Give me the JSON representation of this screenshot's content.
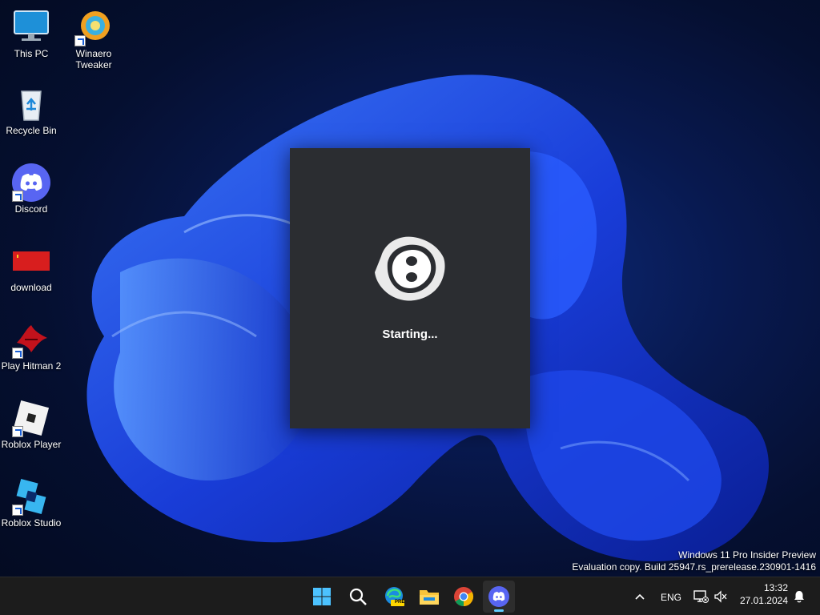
{
  "desktop": {
    "icons": [
      {
        "label_lines": [
          "This PC"
        ],
        "icon": "monitor-icon"
      },
      {
        "label_lines": [
          "Winaero",
          "Tweaker"
        ],
        "icon": "winaero-tweaker-icon"
      },
      {
        "label_lines": [
          "Recycle Bin"
        ],
        "icon": "recycle-bin-icon"
      },
      {
        "label_lines": [
          "Discord"
        ],
        "icon": "discord-icon"
      },
      {
        "label_lines": [
          "download"
        ],
        "icon": "flag-image-icon"
      },
      {
        "label_lines": [
          "Play Hitman 2"
        ],
        "icon": "hitman-icon"
      },
      {
        "label_lines": [
          "Roblox Player"
        ],
        "icon": "roblox-icon"
      },
      {
        "label_lines": [
          "Roblox Studio"
        ],
        "icon": "roblox-studio-icon"
      }
    ]
  },
  "splash": {
    "status": "Starting...",
    "icon": "discord-loading-icon"
  },
  "watermark": {
    "line1": "Windows 11 Pro Insider Preview",
    "line2": "Evaluation copy. Build 25947.rs_prerelease.230901-1416"
  },
  "taskbar": {
    "apps": [
      {
        "icon": "windows-start-icon"
      },
      {
        "icon": "search-icon"
      },
      {
        "icon": "edge-preview-icon",
        "badge": "PRE"
      },
      {
        "icon": "file-explorer-icon"
      },
      {
        "icon": "chrome-icon"
      },
      {
        "icon": "discord-icon",
        "active": true
      }
    ],
    "tray": {
      "language": "ENG",
      "time": "13:32",
      "date": "27.01.2024"
    }
  },
  "colors": {
    "splash_bg": "#2b2d31",
    "discord_blurple": "#5865f2",
    "taskbar_bg": "#1c1c1c",
    "active_indicator": "#60cdff"
  }
}
